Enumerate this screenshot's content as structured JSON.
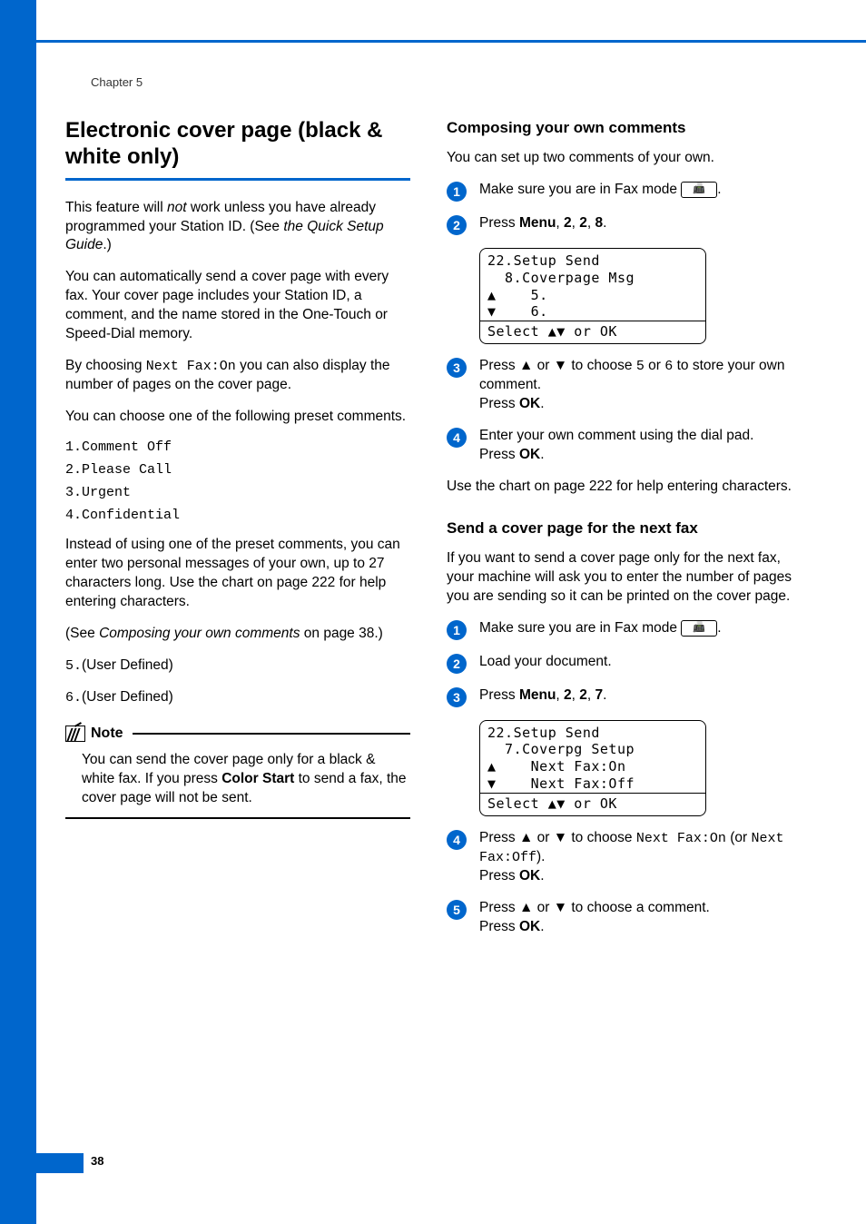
{
  "chapter": "Chapter 5",
  "page_number": "38",
  "left": {
    "title": "Electronic cover page (black & white only)",
    "p1_a": "This feature will ",
    "p1_not": "not",
    "p1_b": " work unless you have already programmed your Station ID. (See ",
    "p1_c": "the Quick Setup Guide",
    "p1_d": ".)",
    "p2": "You can automatically send a cover page with every fax. Your cover page includes your Station ID, a comment, and the name stored in the One-Touch or Speed-Dial memory.",
    "p3_a": "By choosing ",
    "p3_b": "Next Fax:On",
    "p3_c": " you can also display the number of pages on the cover page.",
    "p4": "You can choose one of the following preset comments.",
    "presets": [
      "1.Comment Off",
      "2.Please Call",
      "3.Urgent",
      "4.Confidential"
    ],
    "p5": "Instead of using one of the preset comments, you can enter two personal messages of your own, up to 27 characters long. Use the chart on page 222 for help entering characters.",
    "p6_a": "(See ",
    "p6_b": "Composing your own comments",
    "p6_c": " on page 38.)",
    "user1": "5.",
    "user1_b": "(User Defined)",
    "user2": "6.",
    "user2_b": "(User Defined)",
    "note_label": "Note",
    "note_body_a": "You can send the cover page only for a black & white fax. If you press ",
    "note_body_b": "Color Start",
    "note_body_c": " to send a fax, the cover page will not be sent."
  },
  "right": {
    "sub1": "Composing your own comments",
    "p1": "You can set up two comments of your own.",
    "step1_a": "Make sure you are in Fax mode ",
    "step1_b": ".",
    "step2_a": "Press ",
    "step2_b": "Menu",
    "step2_c": ", ",
    "step2_d": "2",
    "step2_e": ", ",
    "step2_f": "2",
    "step2_g": ", ",
    "step2_h": "8",
    "step2_i": ".",
    "lcd1": {
      "l1": "22.Setup Send",
      "l2": "  8.Coverpage Msg",
      "l3": "▲    5.",
      "l4": "▼    6.",
      "bottom": "Select ▲▼ or OK"
    },
    "step3_a": "Press ",
    "step3_up": "▲",
    "step3_b": " or ",
    "step3_down": "▼",
    "step3_c": " to choose ",
    "step3_d": "5",
    "step3_e": " or ",
    "step3_f": "6",
    "step3_g": " to store your own comment.",
    "step3_h": "Press ",
    "step3_ok": "OK",
    "step3_i": ".",
    "step4_a": "Enter your own comment using the dial pad.",
    "step4_b": "Press ",
    "step4_ok": "OK",
    "step4_c": ".",
    "p2": "Use the chart on page 222 for help entering characters.",
    "sub2": "Send a cover page for the next fax",
    "p3": "If you want to send a cover page only for the next fax, your machine will ask you to enter the number of pages you are sending so it can be printed on the cover page.",
    "s2step1_a": "Make sure you are in Fax mode ",
    "s2step1_b": ".",
    "s2step2": "Load your document.",
    "s2step3_a": "Press ",
    "s2step3_b": "Menu",
    "s2step3_c": ", ",
    "s2step3_d": "2",
    "s2step3_e": ", ",
    "s2step3_f": "2",
    "s2step3_g": ", ",
    "s2step3_h": "7",
    "s2step3_i": ".",
    "lcd2": {
      "l1": "22.Setup Send",
      "l2": "  7.Coverpg Setup",
      "l3": "▲    Next Fax:On",
      "l4": "▼    Next Fax:Off",
      "bottom": "Select ▲▼ or OK"
    },
    "s2step4_a": "Press ",
    "s2step4_up": "▲",
    "s2step4_b": " or ",
    "s2step4_down": "▼",
    "s2step4_c": " to choose ",
    "s2step4_d": "Next Fax:On",
    "s2step4_e": " (or ",
    "s2step4_f": "Next Fax:Off",
    "s2step4_g": ").",
    "s2step4_h": "Press ",
    "s2step4_ok": "OK",
    "s2step4_i": ".",
    "s2step5_a": "Press ",
    "s2step5_up": "▲",
    "s2step5_b": " or ",
    "s2step5_down": "▼",
    "s2step5_c": " to choose a comment.",
    "s2step5_d": "Press ",
    "s2step5_ok": "OK",
    "s2step5_e": "."
  }
}
